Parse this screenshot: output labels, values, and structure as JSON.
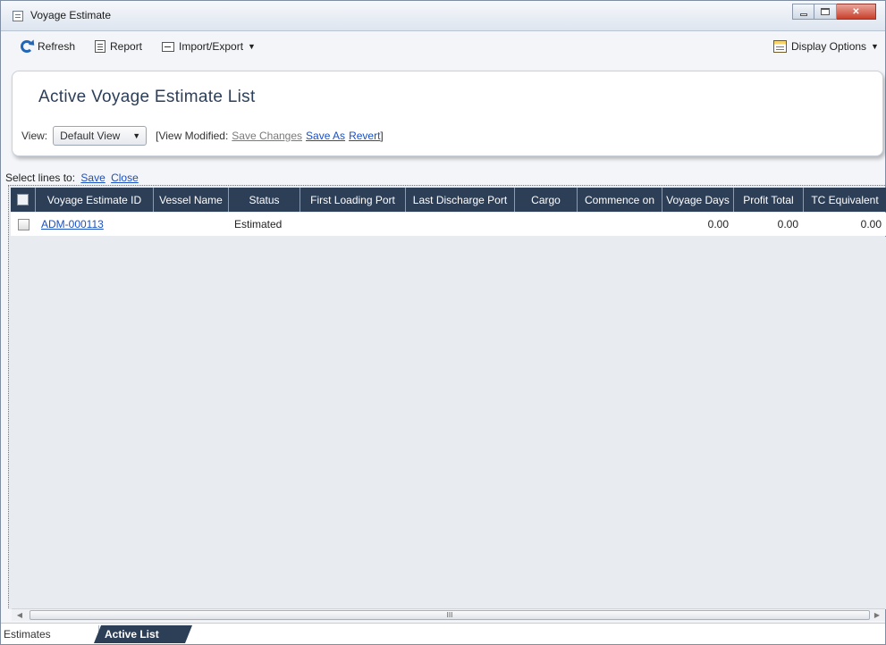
{
  "window": {
    "title": "Voyage Estimate"
  },
  "toolbar": {
    "refresh_label": "Refresh",
    "report_label": "Report",
    "import_export_label": "Import/Export",
    "display_options_label": "Display Options"
  },
  "header": {
    "page_title": "Active Voyage Estimate List",
    "view_label": "View:",
    "view_selected": "Default View",
    "view_modified_prefix": "[View Modified:",
    "save_changes_label": "Save Changes",
    "save_as_label": "Save As",
    "revert_label": "Revert",
    "view_modified_suffix": "]"
  },
  "select_lines": {
    "prefix": "Select lines to:",
    "save_label": "Save",
    "close_label": "Close"
  },
  "grid": {
    "columns": [
      "Voyage Estimate ID",
      "Vessel Name",
      "Status",
      "First Loading Port",
      "Last Discharge Port",
      "Cargo",
      "Commence on",
      "Voyage Days",
      "Profit Total",
      "TC Equivalent"
    ],
    "rows": [
      {
        "voyage_estimate_id": "ADM-000113",
        "vessel_name": "",
        "status": "Estimated",
        "first_loading_port": "",
        "last_discharge_port": "",
        "cargo": "",
        "commence_on": "",
        "voyage_days": "0.00",
        "profit_total": "0.00",
        "tc_equivalent": "0.00"
      }
    ]
  },
  "scrollbar": {
    "thumb_grip": "III"
  },
  "tabs": [
    {
      "label": "Estimates",
      "active": false
    },
    {
      "label": "Active List",
      "active": true
    }
  ],
  "colors": {
    "header_bg": "#2d3e57",
    "link": "#1a4fc4",
    "grid_bg": "#e8ebef"
  }
}
